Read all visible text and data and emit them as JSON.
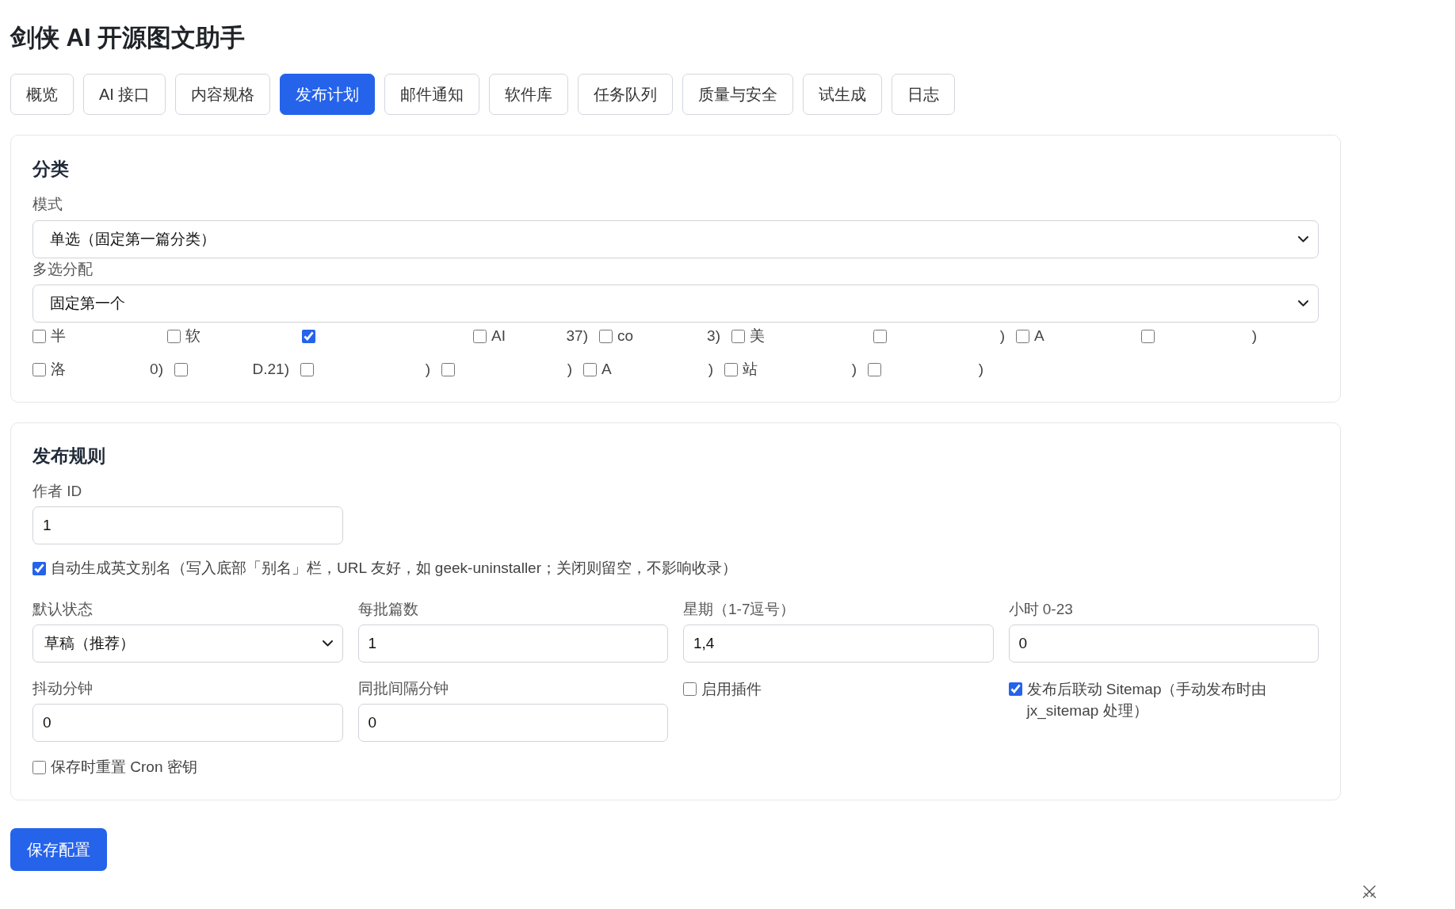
{
  "app": {
    "title": "剑侠 AI 开源图文助手"
  },
  "tabs": [
    {
      "label": "概览",
      "selected": false
    },
    {
      "label": "AI 接口",
      "selected": false
    },
    {
      "label": "内容规格",
      "selected": false
    },
    {
      "label": "发布计划",
      "selected": true
    },
    {
      "label": "邮件通知",
      "selected": false
    },
    {
      "label": "软件库",
      "selected": false
    },
    {
      "label": "任务队列",
      "selected": false
    },
    {
      "label": "质量与安全",
      "selected": false
    },
    {
      "label": "试生成",
      "selected": false
    },
    {
      "label": "日志",
      "selected": false
    }
  ],
  "category_section": {
    "heading": "分类",
    "mode": {
      "label": "模式",
      "value": "单选（固定第一篇分类）"
    },
    "multi_assign": {
      "label": "多选分配",
      "value": "固定第一个"
    },
    "options": [
      {
        "start": "半",
        "checked": false
      },
      {
        "start": "软",
        "checked": false
      },
      {
        "checked": true
      },
      {
        "start": "AI",
        "end": "37)",
        "checked": false
      },
      {
        "start": "co",
        "end": "3)",
        "checked": false
      },
      {
        "start": "美",
        "checked": false
      },
      {
        "end": ")",
        "checked": false
      },
      {
        "start": "A",
        "checked": false
      },
      {
        "end": ")",
        "checked": false
      },
      {
        "start": "洛",
        "end": "0)",
        "checked": false
      },
      {
        "end": "D.21)",
        "checked": false
      },
      {
        "end": ")",
        "checked": false
      },
      {
        "end": ")",
        "checked": false
      },
      {
        "start": "A",
        "end": ")",
        "checked": false
      },
      {
        "start": "站",
        "end": ")",
        "checked": false
      },
      {
        "end": ")",
        "checked": false
      }
    ]
  },
  "publish_rules": {
    "heading": "发布规则",
    "author_id": {
      "label": "作者 ID",
      "value": "1"
    },
    "auto_slug": {
      "label": "自动生成英文别名（写入底部「别名」栏，URL 友好，如 geek-uninstaller；关闭则留空，不影响收录）",
      "checked": true
    },
    "fields": [
      {
        "kind": "select",
        "label": "默认状态",
        "value": "草稿（推荐）"
      },
      {
        "kind": "input",
        "label": "每批篇数",
        "value": "1"
      },
      {
        "kind": "input",
        "label": "星期（1-7逗号）",
        "value": "1,4"
      },
      {
        "kind": "input",
        "label": "小时 0-23",
        "value": "0"
      },
      {
        "kind": "input",
        "label": "抖动分钟",
        "value": "0"
      },
      {
        "kind": "input",
        "label": "同批间隔分钟",
        "value": "0"
      },
      {
        "kind": "checkbox",
        "label": "启用插件",
        "checked": false
      },
      {
        "kind": "checkbox",
        "label": "发布后联动 Sitemap（手动发布时由 jx_sitemap 处理）",
        "checked": true
      }
    ],
    "reset_cron": {
      "label": "保存时重置 Cron 密钥",
      "checked": false
    }
  },
  "save_button": {
    "label": "保存配置"
  }
}
